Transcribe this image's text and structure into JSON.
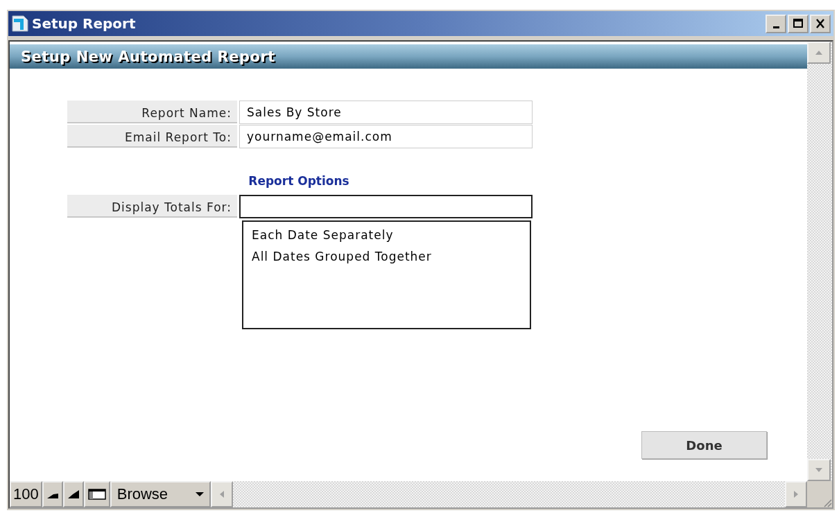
{
  "window": {
    "title": "Setup Report"
  },
  "header": {
    "title": "Setup New Automated Report"
  },
  "fields": [
    {
      "label": "Report Name:",
      "value": "Sales By Store"
    },
    {
      "label": "Email Report To:",
      "value": "yourname@email.com"
    }
  ],
  "section_title": "Report Options",
  "display_totals": {
    "label": "Display Totals For:",
    "options": [
      {
        "label": "Each Date Separately",
        "selected": false
      },
      {
        "label": "All Dates Grouped Together",
        "selected": false
      }
    ]
  },
  "done_button": "Done",
  "status_bar": {
    "zoom": "100",
    "mode": "Browse"
  }
}
